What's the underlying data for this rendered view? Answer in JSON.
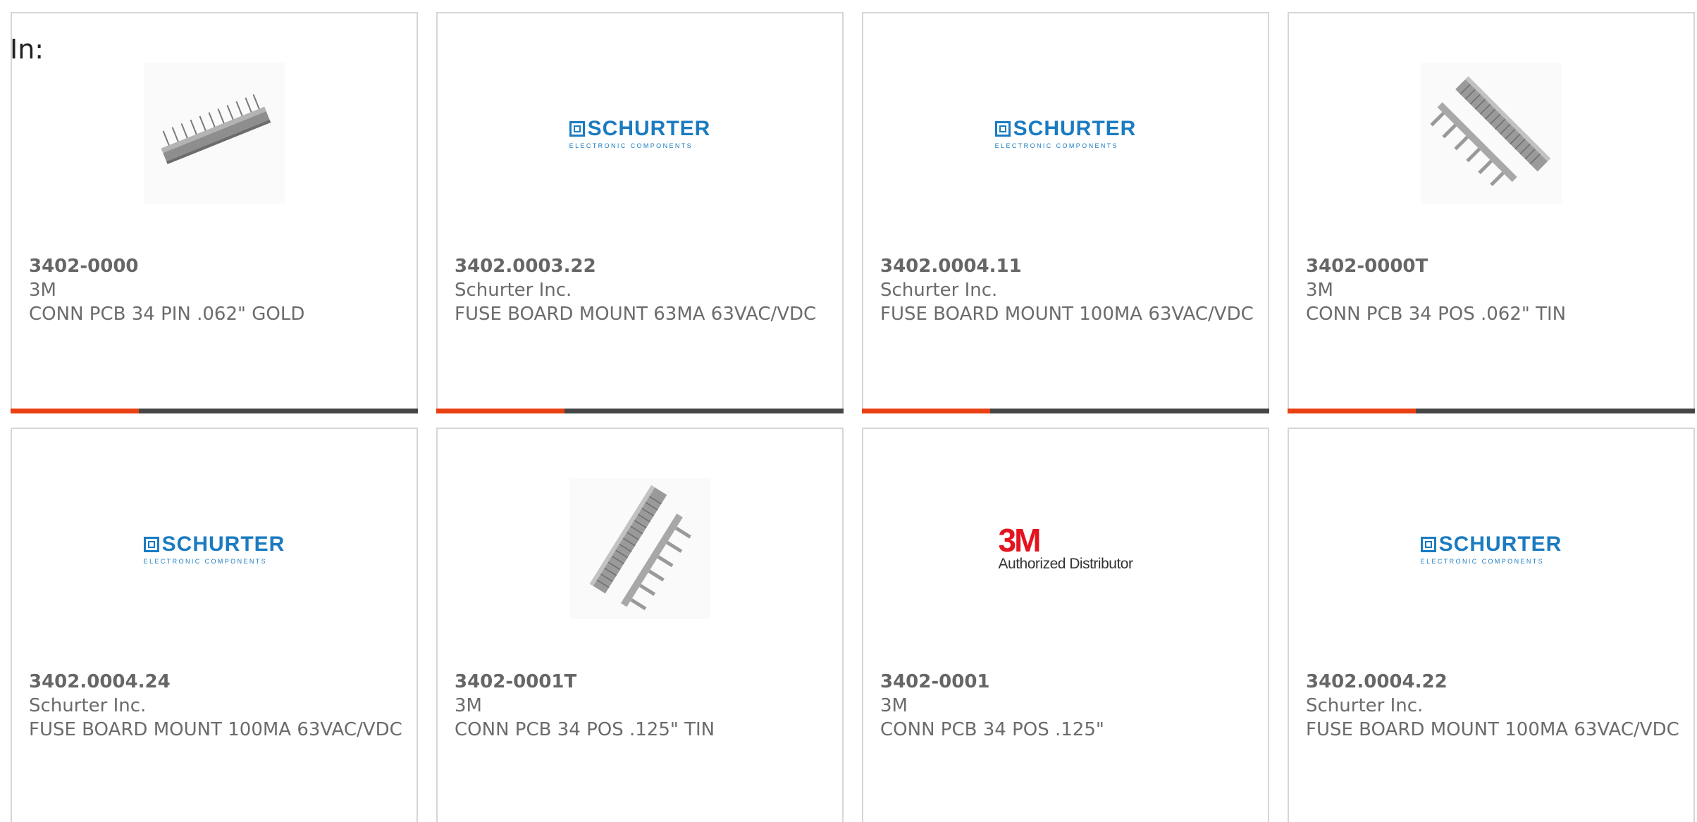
{
  "heading": "In:",
  "colors": {
    "accent": "#e84012",
    "bar": "#454545",
    "border": "#d6d6d6",
    "text": "#6b6b6b",
    "schurter_blue": "#1a7bc1",
    "threem_red": "#e3141f"
  },
  "logos": {
    "schurter": {
      "name": "SCHURTER",
      "tagline": "ELECTRONIC COMPONENTS"
    },
    "threem": {
      "name": "3M",
      "tagline": "Authorized Distributor"
    }
  },
  "products": [
    {
      "part_number": "3402-0000",
      "manufacturer": "3M",
      "description": "CONN PCB 34 PIN .062\" GOLD",
      "image": "header-connector-photo"
    },
    {
      "part_number": "3402.0003.22",
      "manufacturer": "Schurter Inc.",
      "description": "FUSE BOARD MOUNT 63MA 63VAC/VDC",
      "image": "schurter-logo"
    },
    {
      "part_number": "3402.0004.11",
      "manufacturer": "Schurter Inc.",
      "description": "FUSE BOARD MOUNT 100MA 63VAC/VDC",
      "image": "schurter-logo"
    },
    {
      "part_number": "3402-0000T",
      "manufacturer": "3M",
      "description": "CONN PCB 34 POS .062\" TIN",
      "image": "dual-row-connector-photo"
    },
    {
      "part_number": "3402.0004.24",
      "manufacturer": "Schurter Inc.",
      "description": "FUSE BOARD MOUNT 100MA 63VAC/VDC",
      "image": "schurter-logo"
    },
    {
      "part_number": "3402-0001T",
      "manufacturer": "3M",
      "description": "CONN PCB 34 POS .125\" TIN",
      "image": "dual-row-connector-photo"
    },
    {
      "part_number": "3402-0001",
      "manufacturer": "3M",
      "description": "CONN PCB 34 POS .125\"",
      "image": "3m-logo"
    },
    {
      "part_number": "3402.0004.22",
      "manufacturer": "Schurter Inc.",
      "description": "FUSE BOARD MOUNT 100MA 63VAC/VDC",
      "image": "schurter-logo"
    }
  ]
}
